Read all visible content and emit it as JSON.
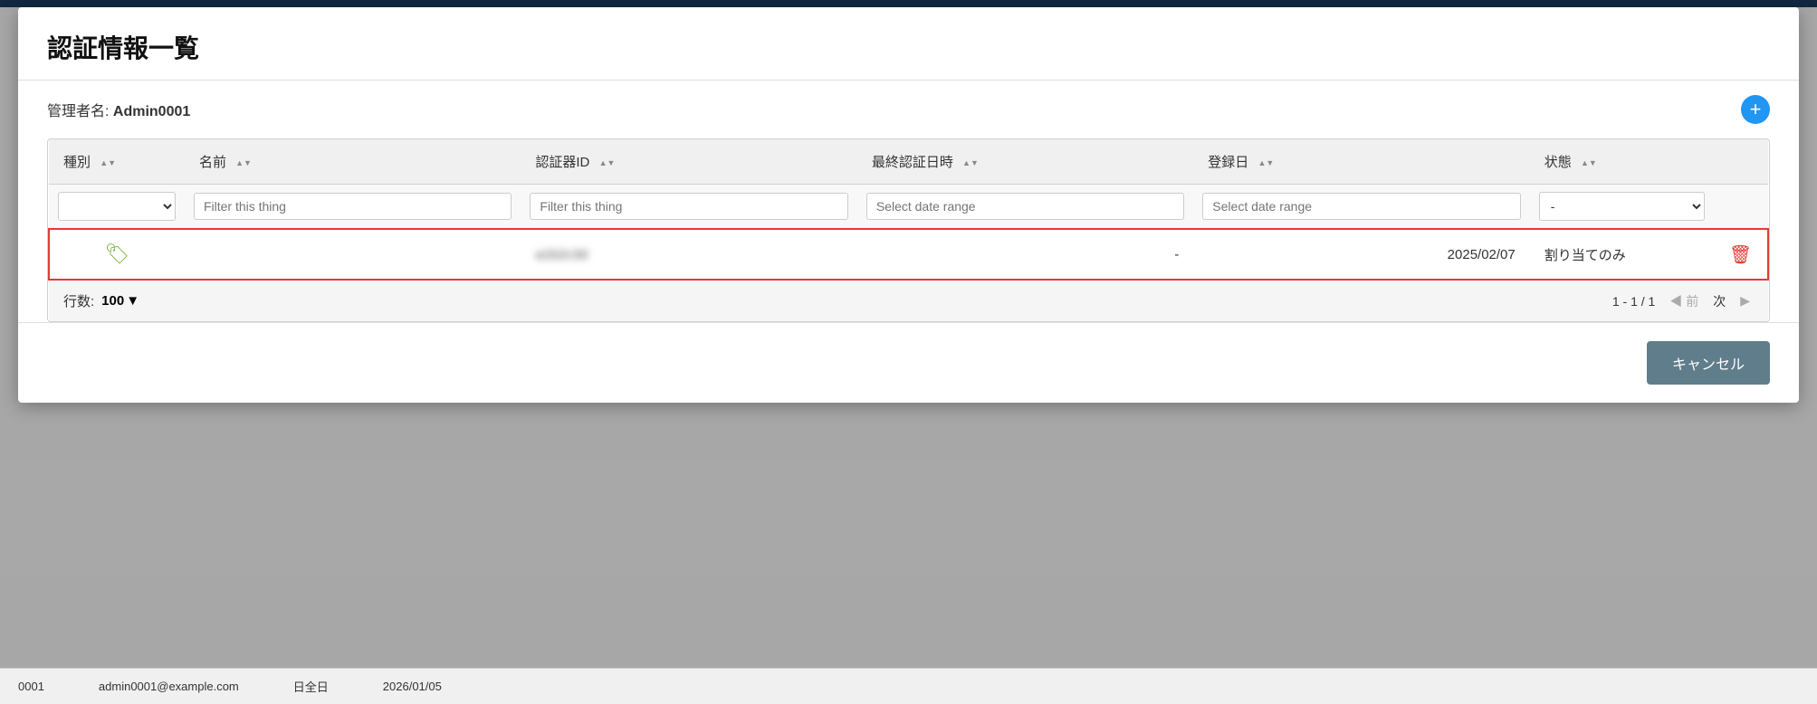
{
  "modal": {
    "title": "認証情報一覧",
    "admin_label": "管理者名:",
    "admin_value": "Admin0001"
  },
  "add_button_label": "+",
  "table": {
    "columns": [
      {
        "key": "type",
        "label": "種別"
      },
      {
        "key": "name",
        "label": "名前"
      },
      {
        "key": "auth_id",
        "label": "認証器ID"
      },
      {
        "key": "last_auth",
        "label": "最終認証日時"
      },
      {
        "key": "reg_date",
        "label": "登録日"
      },
      {
        "key": "status",
        "label": "状態"
      }
    ],
    "filters": {
      "type_placeholder": "",
      "name_placeholder": "Filter this thing",
      "auth_id_placeholder": "Filter this thing",
      "last_auth_placeholder": "Select date range",
      "reg_date_placeholder": "Select date range",
      "status_options": [
        "-"
      ]
    },
    "rows": [
      {
        "type_icon": "tag",
        "name": "",
        "auth_id": "XXXXXXX",
        "last_auth": "-",
        "reg_date": "2025/02/07",
        "status": "割り当てのみ"
      }
    ]
  },
  "footer": {
    "rows_label": "行数:",
    "rows_value": "100",
    "pagination_info": "1 - 1 / 1",
    "prev_label": "前",
    "next_label": "次"
  },
  "cancel_button": "キャンセル",
  "bottom_bar": {
    "user": "0001",
    "email": "admin0001@example.com",
    "date": "日全日",
    "time": "2026/01/05"
  }
}
